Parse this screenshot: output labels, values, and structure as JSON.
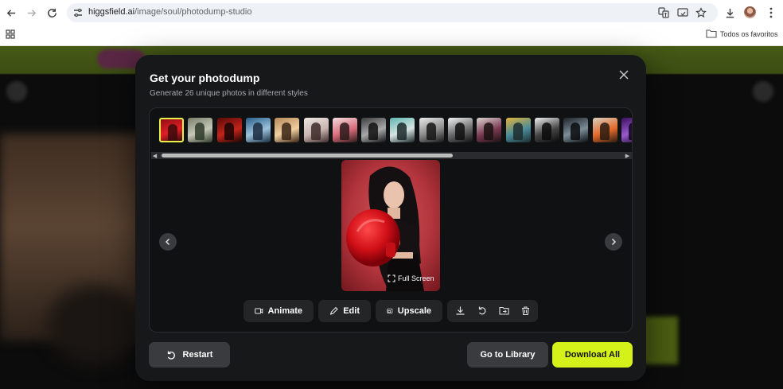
{
  "browser": {
    "url_domain": "higgsfield.ai",
    "url_path": "/image/soul/photodump-studio",
    "bookmark_folder": "Todos os favoritos"
  },
  "modal": {
    "title": "Get your photodump",
    "subtitle": "Generate 26 unique photos in different styles",
    "fullscreen_label": "Full Screen",
    "toolbar": {
      "animate": "Animate",
      "edit": "Edit",
      "upscale": "Upscale"
    },
    "footer": {
      "restart": "Restart",
      "library": "Go to Library",
      "download_all": "Download All"
    },
    "thumbnail_count": 17,
    "selected_thumbnail": 1
  },
  "colors": {
    "accent": "#d4f21a",
    "modal_bg": "#17181a",
    "panel_bg": "#101113",
    "button_bg": "#3a3b3e",
    "selected_border": "#e4f14a"
  },
  "icons": {
    "back": "arrow-left-icon",
    "forward": "arrow-right-icon",
    "reload": "reload-icon",
    "site_info": "tune-icon",
    "translate": "translate-icon",
    "cast": "cast-icon",
    "bookmark": "star-icon",
    "downloads": "download-icon",
    "menu": "more-vert-icon",
    "apps": "apps-grid-icon",
    "folder": "folder-icon",
    "close": "close-icon",
    "prev": "chevron-left-icon",
    "next": "chevron-right-icon",
    "fullscreen": "fullscreen-icon",
    "animate": "video-icon",
    "edit": "pencil-icon",
    "upscale": "upscale-icon",
    "item_download": "download-icon",
    "redo": "redo-icon",
    "move": "folder-move-icon",
    "delete": "trash-icon",
    "restart": "restart-icon"
  }
}
